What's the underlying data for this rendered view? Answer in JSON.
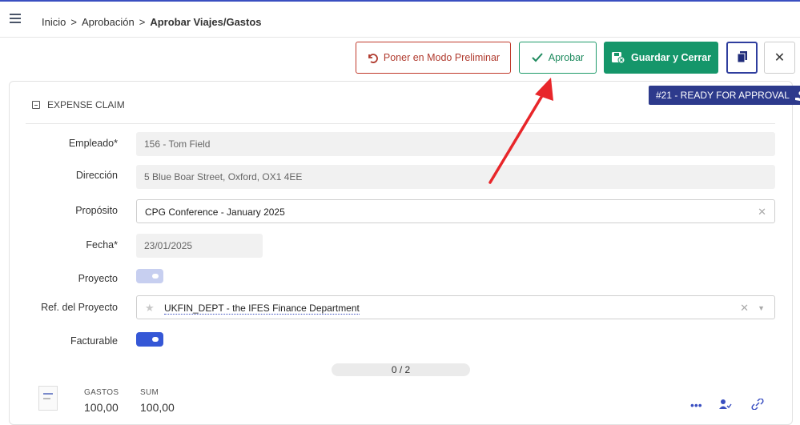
{
  "breadcrumb": {
    "home": "Inicio",
    "separator": ">",
    "parent": "Aprobación",
    "current": "Aprobar Viajes/Gastos"
  },
  "toolbar": {
    "draft_label": "Poner en Modo Preliminar",
    "approve_label": "Aprobar",
    "save_label": "Guardar y Cerrar",
    "close_label": "✕"
  },
  "status_badge": "#21 - READY FOR APPROVAL",
  "section": {
    "title": "EXPENSE CLAIM"
  },
  "form": {
    "employee_label": "Empleado*",
    "employee_value": "156 - Tom Field",
    "address_label": "Dirección",
    "address_value": "5 Blue Boar Street, Oxford, OX1 4EE",
    "purpose_label": "Propósito",
    "purpose_value": "CPG Conference - January 2025",
    "date_label": "Fecha*",
    "date_value": "23/01/2025",
    "project_label": "Proyecto",
    "project_ref_label": "Ref. del Proyecto",
    "project_ref_value": "UKFIN_DEPT - the IFES Finance Department",
    "billable_label": "Facturable"
  },
  "toggles": {
    "project_on": false,
    "billable_on": true
  },
  "pager": "0 / 2",
  "summary": {
    "expenses_label": "GASTOS",
    "expenses_value": "100,00",
    "sum_label": "SUM",
    "sum_value": "100,00"
  },
  "colors": {
    "accent": "#3a4fc1",
    "draft_red": "#c0392b",
    "approve_green": "#1e9a6a",
    "save_green": "#15966a",
    "status_navy": "#2d3a8c",
    "annotation_red": "#e8262a"
  },
  "icons": {
    "menu": "hamburger-icon",
    "draft": "undo-icon",
    "approve": "check-icon",
    "save": "save-close-icon",
    "copy": "copy-icon",
    "close": "close-icon",
    "status": "user-hand-icon",
    "favorite": "star-icon"
  }
}
